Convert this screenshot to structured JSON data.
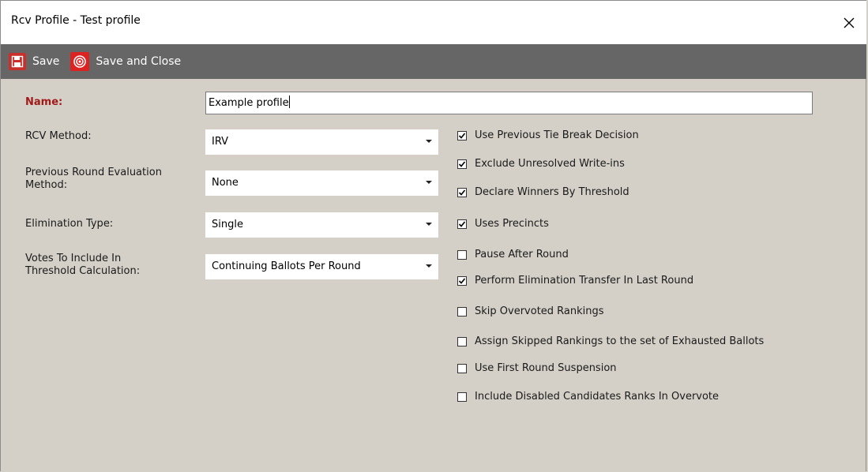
{
  "window": {
    "title": "Rcv Profile - Test profile",
    "close_icon": "close-icon"
  },
  "toolbar": {
    "save_label": "Save",
    "save_close_label": "Save and Close",
    "icons": {
      "save": "floppy-disk-icon",
      "save_close": "target-close-icon"
    }
  },
  "form": {
    "name_label": "Name:",
    "name_value": "Example profile",
    "rcv_method": {
      "label": "RCV Method:",
      "value": "IRV"
    },
    "prev_round": {
      "label_line1": "Previous Round Evaluation",
      "label_line2": "Method:",
      "value": "None"
    },
    "elimination": {
      "label": "Elimination Type:",
      "value": "Single"
    },
    "votes_threshold": {
      "label_line1": "Votes To Include In",
      "label_line2": "Threshold Calculation:",
      "value": "Continuing Ballots Per Round"
    }
  },
  "options": [
    {
      "label": "Use Previous Tie Break Decision",
      "checked": true
    },
    {
      "label": "Exclude Unresolved Write-ins",
      "checked": true
    },
    {
      "label": "Declare Winners By Threshold",
      "checked": true
    },
    {
      "label": "Uses Precincts",
      "checked": true
    },
    {
      "label": "Pause After Round",
      "checked": false
    },
    {
      "label": "Perform Elimination Transfer In Last Round",
      "checked": true
    },
    {
      "label": "Skip Overvoted Rankings",
      "checked": false
    },
    {
      "label": "Assign Skipped Rankings to the set of Exhausted Ballots",
      "checked": false
    },
    {
      "label": "Use First Round Suspension",
      "checked": false
    },
    {
      "label": "Include Disabled Candidates Ranks In Overvote",
      "checked": false
    }
  ],
  "colors": {
    "toolbar_bg": "#666666",
    "panel_bg": "#d4d0c8",
    "name_label": "#a11a1a",
    "icon_red": "#c9302c"
  }
}
